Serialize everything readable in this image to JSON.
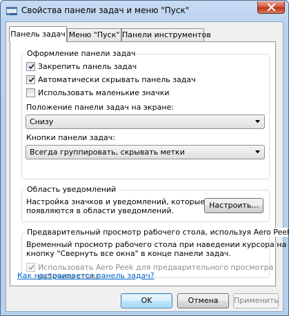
{
  "window": {
    "title": "Свойства панели задач и меню \"Пуск\""
  },
  "tabs": [
    {
      "label": "Панель задач",
      "active": true
    },
    {
      "label": "Меню \"Пуск\"",
      "active": false
    },
    {
      "label": "Панели инструментов",
      "active": false
    }
  ],
  "appearance": {
    "title": "Оформление панели задач",
    "checkboxes": [
      {
        "label": "Закрепить панель задач",
        "checked": true
      },
      {
        "label": "Автоматически скрывать панель задач",
        "checked": true
      },
      {
        "label": "Использовать маленькие значки",
        "checked": false
      }
    ],
    "position_label": "Положение панели задач на экране:",
    "position_value": "Снизу",
    "buttons_label": "Кнопки панели задач:",
    "buttons_value": "Всегда группировать, скрывать метки"
  },
  "notifications": {
    "title": "Область уведомлений",
    "description_line1": "Настройка значков и уведомлений, которые",
    "description_line2": "появляются в области уведомлений.",
    "customize_button": "Настроить..."
  },
  "aero_peek": {
    "title": "Предварительный просмотр рабочего стола, используя Aero Peek",
    "description_line1": "Временный просмотр рабочего стола при наведении курсора на",
    "description_line2": "кнопку \"Свернуть все окна\" в конце панели задач.",
    "checkbox_line1": "Использовать Aero Peek для предварительного просмотра",
    "checkbox_line2": "рабочего стола",
    "checkbox_checked": true,
    "checkbox_disabled": true
  },
  "help_link": "Как настраивается панель задач?",
  "footer": {
    "ok": "OK",
    "cancel": "Отмена",
    "apply": "Применить"
  }
}
